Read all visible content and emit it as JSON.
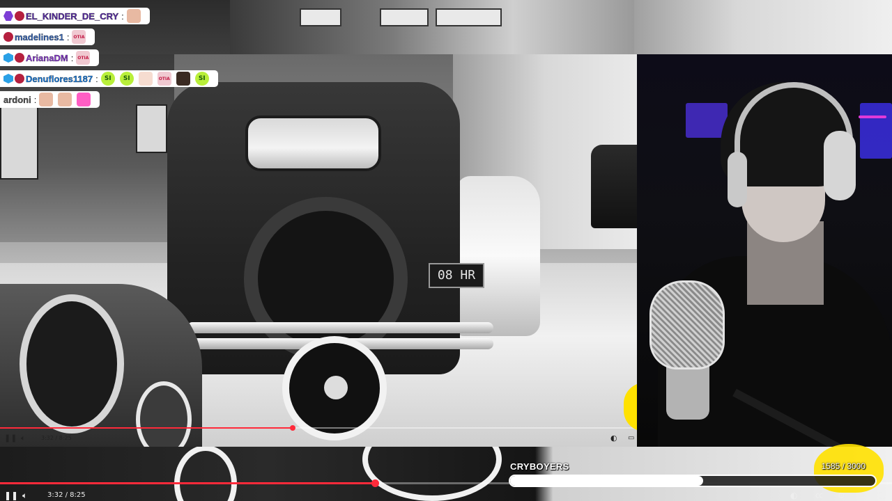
{
  "chat": [
    {
      "badges": [
        "hex",
        "bear"
      ],
      "username": "EL_KINDER_DE_CRY",
      "color": "#5b2ea8",
      "emotes": [
        {
          "kind": "face",
          "text": ""
        }
      ]
    },
    {
      "badges": [
        "bear"
      ],
      "username": "madelines1",
      "color": "#3a6bbd",
      "emotes": [
        {
          "kind": "otia",
          "text": "OTIA"
        }
      ]
    },
    {
      "badges": [
        "cube",
        "bear"
      ],
      "username": "ArianaDM",
      "color": "#8a3ad1",
      "emotes": [
        {
          "kind": "otia",
          "text": "OTIA"
        }
      ]
    },
    {
      "badges": [
        "cube",
        "bear"
      ],
      "username": "Denuflores1187",
      "color": "#1c7fe0",
      "emotes": [
        {
          "kind": "si",
          "text": "SI"
        },
        {
          "kind": "si",
          "text": "SI"
        },
        {
          "kind": "bald",
          "text": ""
        },
        {
          "kind": "otia",
          "text": "OTIA"
        },
        {
          "kind": "dark",
          "text": ""
        },
        {
          "kind": "si",
          "text": "SI"
        }
      ]
    },
    {
      "badges": [],
      "username": "ardoni",
      "color": "#555555",
      "emotes": [
        {
          "kind": "face",
          "text": ""
        },
        {
          "kind": "face",
          "text": ""
        },
        {
          "kind": "pink",
          "text": ""
        }
      ]
    }
  ],
  "inner_player": {
    "time": "3:32 / 8:25",
    "progress_fraction": 0.46,
    "plate_text": "08 HR"
  },
  "outer_player": {
    "time": "3:32 / 8:25",
    "progress_fraction": 0.42
  },
  "goal": {
    "title": "CRYBOYERS",
    "current": 1585,
    "target": 3000,
    "count_text": "1585  / 3000",
    "fill_fraction": 0.528
  },
  "colors": {
    "progress_red": "#ff2a3a",
    "goal_fill": "#ffffff",
    "brand_yellow": "#ffe100"
  },
  "icons": {
    "pause": "pause-icon",
    "volume": "volume-icon",
    "autoplay": "autoplay-toggle-icon",
    "captions": "captions-icon",
    "settings": "settings-icon",
    "miniplayer": "miniplayer-icon",
    "fullscreen": "fullscreen-icon"
  }
}
